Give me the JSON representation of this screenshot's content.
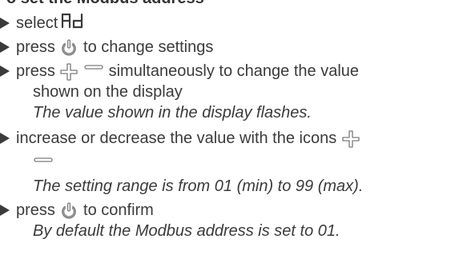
{
  "heading": "o set the Modbus address",
  "steps": {
    "select_text": "select",
    "display_code": "Ad",
    "press1_text": "press",
    "press1_suffix": "to change settings",
    "press2_text": "press",
    "press2_suffix": "simultaneously to change the value",
    "press2_line2": "shown on the display",
    "note1": "The value shown in the display flashes.",
    "adjust_text": "increase or decrease the value with the icons",
    "note2": "The setting range is from 01 (min) to 99 (max).",
    "confirm_text": "press",
    "confirm_suffix": "to confirm",
    "note3": "By default the Modbus address is set to 01."
  },
  "icons": {
    "power": "power-icon",
    "plus": "plus-icon",
    "minus": "minus-icon",
    "segment_display": "seven-segment-ad-icon"
  },
  "colors": {
    "text": "#3b3b3b",
    "heading": "#333333",
    "icon_stroke": "#7a7a7a"
  }
}
